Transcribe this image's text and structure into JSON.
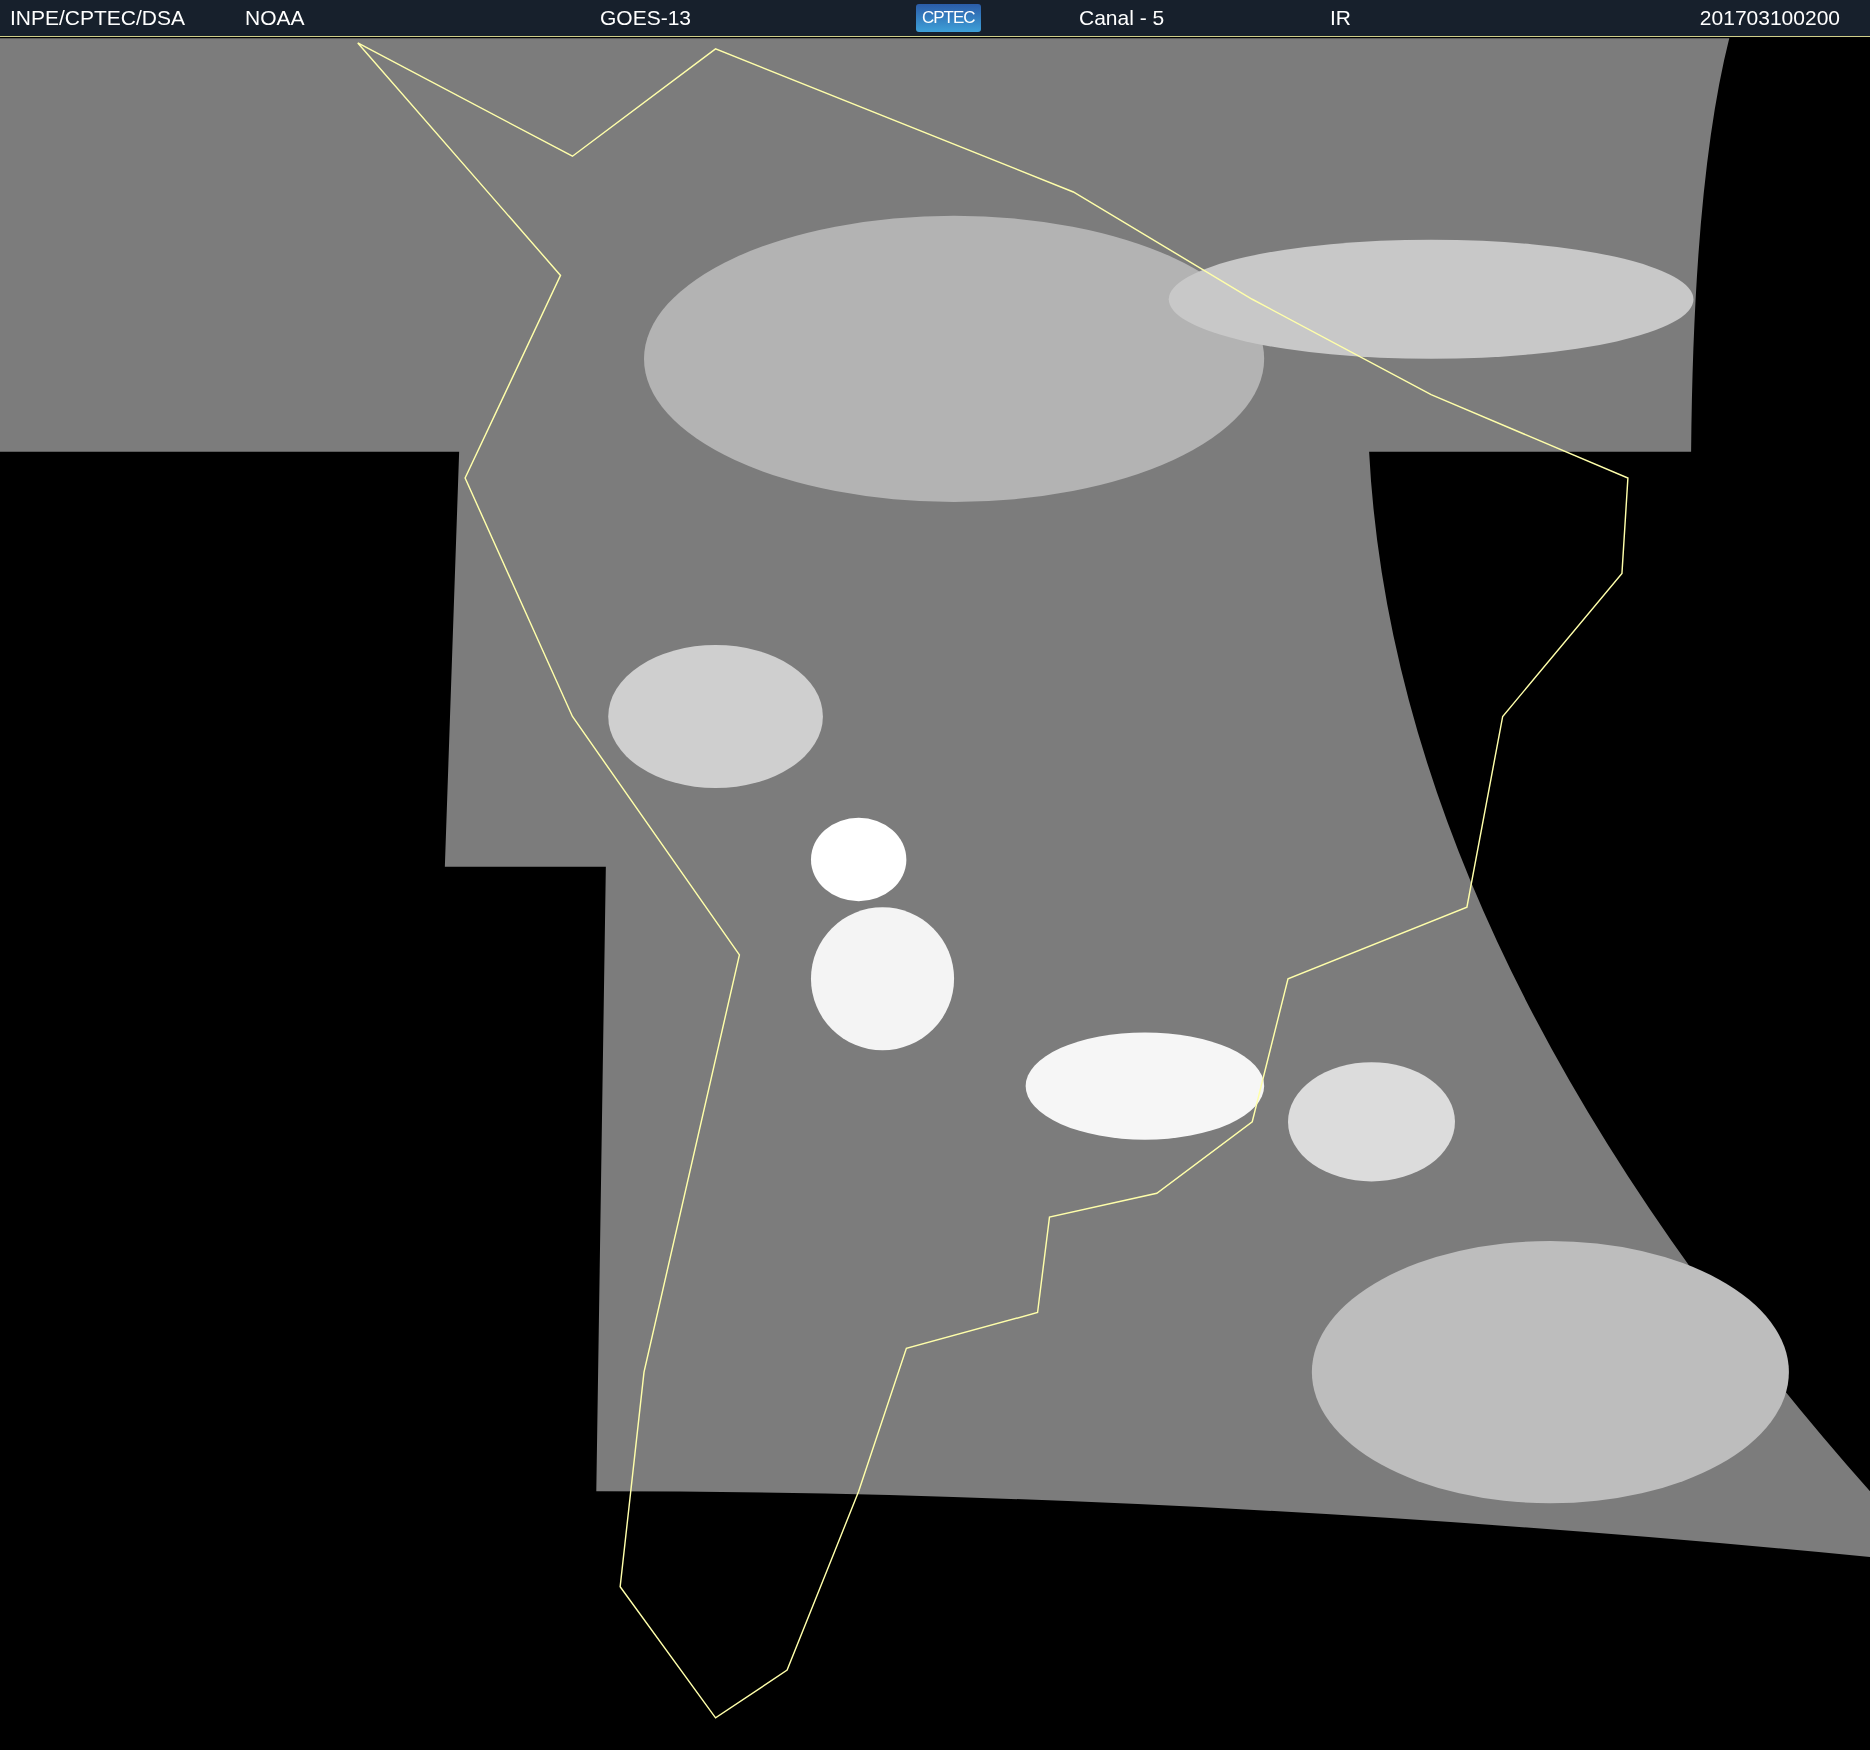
{
  "header": {
    "items": [
      {
        "kind": "text",
        "text": "INPE/CPTEC/DSA"
      },
      {
        "kind": "text",
        "text": "NOAA"
      },
      {
        "kind": "text",
        "text": "GOES-13"
      },
      {
        "kind": "logo",
        "text": "CPTEC"
      },
      {
        "kind": "text",
        "text": "Canal - 5"
      },
      {
        "kind": "text",
        "text": "IR"
      },
      {
        "kind": "text",
        "text": "201703100200"
      }
    ]
  }
}
